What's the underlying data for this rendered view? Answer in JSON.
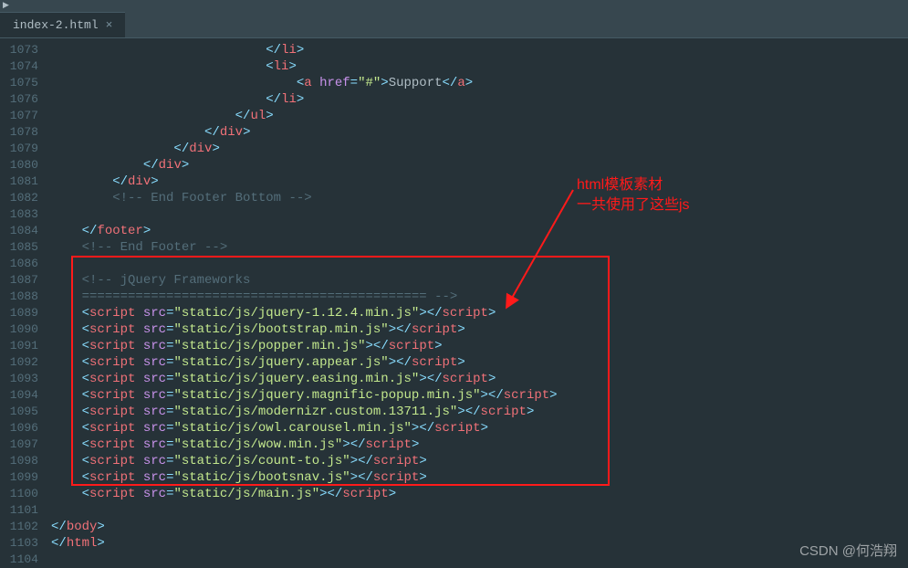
{
  "tab": {
    "filename": "index-2.html",
    "close_glyph": "×"
  },
  "toolbar": {
    "play_glyph": "▶"
  },
  "gutter_start": 1073,
  "gutter_end": 1104,
  "annotation": {
    "line1": "html模板素材",
    "line2": "一共使用了这些js"
  },
  "watermark": "CSDN @何浩翔",
  "code_lines": [
    {
      "indent": 28,
      "tokens": [
        {
          "c": "p",
          "t": "</"
        },
        {
          "c": "t",
          "t": "li"
        },
        {
          "c": "p",
          "t": ">"
        }
      ]
    },
    {
      "indent": 28,
      "tokens": [
        {
          "c": "p",
          "t": "<"
        },
        {
          "c": "t",
          "t": "li"
        },
        {
          "c": "p",
          "t": ">"
        }
      ]
    },
    {
      "indent": 32,
      "tokens": [
        {
          "c": "p",
          "t": "<"
        },
        {
          "c": "t",
          "t": "a"
        },
        {
          "c": "tx",
          "t": " "
        },
        {
          "c": "a",
          "t": "href"
        },
        {
          "c": "p",
          "t": "="
        },
        {
          "c": "s",
          "t": "\"#\""
        },
        {
          "c": "p",
          "t": ">"
        },
        {
          "c": "tx",
          "t": "Support"
        },
        {
          "c": "p",
          "t": "</"
        },
        {
          "c": "t",
          "t": "a"
        },
        {
          "c": "p",
          "t": ">"
        }
      ]
    },
    {
      "indent": 28,
      "tokens": [
        {
          "c": "p",
          "t": "</"
        },
        {
          "c": "t",
          "t": "li"
        },
        {
          "c": "p",
          "t": ">"
        }
      ]
    },
    {
      "indent": 24,
      "tokens": [
        {
          "c": "p",
          "t": "</"
        },
        {
          "c": "t",
          "t": "ul"
        },
        {
          "c": "p",
          "t": ">"
        }
      ]
    },
    {
      "indent": 20,
      "tokens": [
        {
          "c": "p",
          "t": "</"
        },
        {
          "c": "t",
          "t": "div"
        },
        {
          "c": "p",
          "t": ">"
        }
      ]
    },
    {
      "indent": 16,
      "tokens": [
        {
          "c": "p",
          "t": "</"
        },
        {
          "c": "t",
          "t": "div"
        },
        {
          "c": "p",
          "t": ">"
        }
      ]
    },
    {
      "indent": 12,
      "tokens": [
        {
          "c": "p",
          "t": "</"
        },
        {
          "c": "t",
          "t": "div"
        },
        {
          "c": "p",
          "t": ">"
        }
      ]
    },
    {
      "indent": 8,
      "tokens": [
        {
          "c": "p",
          "t": "</"
        },
        {
          "c": "t",
          "t": "div"
        },
        {
          "c": "p",
          "t": ">"
        }
      ]
    },
    {
      "indent": 8,
      "tokens": [
        {
          "c": "c",
          "t": "<!-- End Footer Bottom -->"
        }
      ]
    },
    {
      "indent": 0,
      "tokens": []
    },
    {
      "indent": 4,
      "tokens": [
        {
          "c": "p",
          "t": "</"
        },
        {
          "c": "t",
          "t": "footer"
        },
        {
          "c": "p",
          "t": ">"
        }
      ]
    },
    {
      "indent": 4,
      "tokens": [
        {
          "c": "c",
          "t": "<!-- End Footer -->"
        }
      ]
    },
    {
      "indent": 0,
      "tokens": []
    },
    {
      "indent": 4,
      "tokens": [
        {
          "c": "c",
          "t": "<!-- jQuery Frameworks"
        }
      ]
    },
    {
      "indent": 4,
      "tokens": [
        {
          "c": "c",
          "t": "============================================= -->"
        }
      ]
    },
    {
      "indent": 4,
      "tokens": [
        {
          "c": "p",
          "t": "<"
        },
        {
          "c": "t",
          "t": "script"
        },
        {
          "c": "tx",
          "t": " "
        },
        {
          "c": "a",
          "t": "src"
        },
        {
          "c": "p",
          "t": "="
        },
        {
          "c": "s",
          "t": "\"static/js/jquery-1.12.4.min.js\""
        },
        {
          "c": "p",
          "t": "></"
        },
        {
          "c": "t",
          "t": "script"
        },
        {
          "c": "p",
          "t": ">"
        }
      ]
    },
    {
      "indent": 4,
      "tokens": [
        {
          "c": "p",
          "t": "<"
        },
        {
          "c": "t",
          "t": "script"
        },
        {
          "c": "tx",
          "t": " "
        },
        {
          "c": "a",
          "t": "src"
        },
        {
          "c": "p",
          "t": "="
        },
        {
          "c": "s",
          "t": "\"static/js/bootstrap.min.js\""
        },
        {
          "c": "p",
          "t": "></"
        },
        {
          "c": "t",
          "t": "script"
        },
        {
          "c": "p",
          "t": ">"
        }
      ]
    },
    {
      "indent": 4,
      "tokens": [
        {
          "c": "p",
          "t": "<"
        },
        {
          "c": "t",
          "t": "script"
        },
        {
          "c": "tx",
          "t": " "
        },
        {
          "c": "a",
          "t": "src"
        },
        {
          "c": "p",
          "t": "="
        },
        {
          "c": "s",
          "t": "\"static/js/popper.min.js\""
        },
        {
          "c": "p",
          "t": "></"
        },
        {
          "c": "t",
          "t": "script"
        },
        {
          "c": "p",
          "t": ">"
        }
      ]
    },
    {
      "indent": 4,
      "tokens": [
        {
          "c": "p",
          "t": "<"
        },
        {
          "c": "t",
          "t": "script"
        },
        {
          "c": "tx",
          "t": " "
        },
        {
          "c": "a",
          "t": "src"
        },
        {
          "c": "p",
          "t": "="
        },
        {
          "c": "s",
          "t": "\"static/js/jquery.appear.js\""
        },
        {
          "c": "p",
          "t": "></"
        },
        {
          "c": "t",
          "t": "script"
        },
        {
          "c": "p",
          "t": ">"
        }
      ]
    },
    {
      "indent": 4,
      "tokens": [
        {
          "c": "p",
          "t": "<"
        },
        {
          "c": "t",
          "t": "script"
        },
        {
          "c": "tx",
          "t": " "
        },
        {
          "c": "a",
          "t": "src"
        },
        {
          "c": "p",
          "t": "="
        },
        {
          "c": "s",
          "t": "\"static/js/jquery.easing.min.js\""
        },
        {
          "c": "p",
          "t": "></"
        },
        {
          "c": "t",
          "t": "script"
        },
        {
          "c": "p",
          "t": ">"
        }
      ]
    },
    {
      "indent": 4,
      "tokens": [
        {
          "c": "p",
          "t": "<"
        },
        {
          "c": "t",
          "t": "script"
        },
        {
          "c": "tx",
          "t": " "
        },
        {
          "c": "a",
          "t": "src"
        },
        {
          "c": "p",
          "t": "="
        },
        {
          "c": "s",
          "t": "\"static/js/jquery.magnific-popup.min.js\""
        },
        {
          "c": "p",
          "t": "></"
        },
        {
          "c": "t",
          "t": "script"
        },
        {
          "c": "p",
          "t": ">"
        }
      ]
    },
    {
      "indent": 4,
      "tokens": [
        {
          "c": "p",
          "t": "<"
        },
        {
          "c": "t",
          "t": "script"
        },
        {
          "c": "tx",
          "t": " "
        },
        {
          "c": "a",
          "t": "src"
        },
        {
          "c": "p",
          "t": "="
        },
        {
          "c": "s",
          "t": "\"static/js/modernizr.custom.13711.js\""
        },
        {
          "c": "p",
          "t": "></"
        },
        {
          "c": "t",
          "t": "script"
        },
        {
          "c": "p",
          "t": ">"
        }
      ]
    },
    {
      "indent": 4,
      "tokens": [
        {
          "c": "p",
          "t": "<"
        },
        {
          "c": "t",
          "t": "script"
        },
        {
          "c": "tx",
          "t": " "
        },
        {
          "c": "a",
          "t": "src"
        },
        {
          "c": "p",
          "t": "="
        },
        {
          "c": "s",
          "t": "\"static/js/owl.carousel.min.js\""
        },
        {
          "c": "p",
          "t": "></"
        },
        {
          "c": "t",
          "t": "script"
        },
        {
          "c": "p",
          "t": ">"
        }
      ]
    },
    {
      "indent": 4,
      "tokens": [
        {
          "c": "p",
          "t": "<"
        },
        {
          "c": "t",
          "t": "script"
        },
        {
          "c": "tx",
          "t": " "
        },
        {
          "c": "a",
          "t": "src"
        },
        {
          "c": "p",
          "t": "="
        },
        {
          "c": "s",
          "t": "\"static/js/wow.min.js\""
        },
        {
          "c": "p",
          "t": "></"
        },
        {
          "c": "t",
          "t": "script"
        },
        {
          "c": "p",
          "t": ">"
        }
      ]
    },
    {
      "indent": 4,
      "tokens": [
        {
          "c": "p",
          "t": "<"
        },
        {
          "c": "t",
          "t": "script"
        },
        {
          "c": "tx",
          "t": " "
        },
        {
          "c": "a",
          "t": "src"
        },
        {
          "c": "p",
          "t": "="
        },
        {
          "c": "s",
          "t": "\"static/js/count-to.js\""
        },
        {
          "c": "p",
          "t": "></"
        },
        {
          "c": "t",
          "t": "script"
        },
        {
          "c": "p",
          "t": ">"
        }
      ]
    },
    {
      "indent": 4,
      "tokens": [
        {
          "c": "p",
          "t": "<"
        },
        {
          "c": "t",
          "t": "script"
        },
        {
          "c": "tx",
          "t": " "
        },
        {
          "c": "a",
          "t": "src"
        },
        {
          "c": "p",
          "t": "="
        },
        {
          "c": "s",
          "t": "\"static/js/bootsnav.js\""
        },
        {
          "c": "p",
          "t": "></"
        },
        {
          "c": "t",
          "t": "script"
        },
        {
          "c": "p",
          "t": ">"
        }
      ]
    },
    {
      "indent": 4,
      "tokens": [
        {
          "c": "p",
          "t": "<"
        },
        {
          "c": "t",
          "t": "script"
        },
        {
          "c": "tx",
          "t": " "
        },
        {
          "c": "a",
          "t": "src"
        },
        {
          "c": "p",
          "t": "="
        },
        {
          "c": "s",
          "t": "\"static/js/main.js\""
        },
        {
          "c": "p",
          "t": "></"
        },
        {
          "c": "t",
          "t": "script"
        },
        {
          "c": "p",
          "t": ">"
        }
      ]
    },
    {
      "indent": 0,
      "tokens": []
    },
    {
      "indent": 0,
      "tokens": [
        {
          "c": "p",
          "t": "</"
        },
        {
          "c": "t",
          "t": "body"
        },
        {
          "c": "p",
          "t": ">"
        }
      ]
    },
    {
      "indent": 0,
      "tokens": [
        {
          "c": "p",
          "t": "</"
        },
        {
          "c": "t",
          "t": "html"
        },
        {
          "c": "p",
          "t": ">"
        }
      ]
    },
    {
      "indent": 0,
      "tokens": []
    }
  ]
}
